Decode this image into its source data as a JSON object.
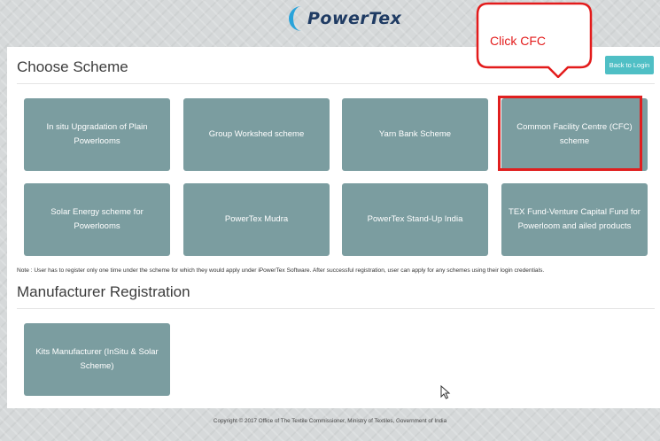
{
  "header": {
    "logo_text": "PowerTex"
  },
  "callout": {
    "text": "Click CFC"
  },
  "scheme_section": {
    "title": "Choose Scheme",
    "back_label": "Back to Login",
    "tiles": [
      {
        "label": "In situ Upgradation of Plain Powerlooms"
      },
      {
        "label": "Group Workshed scheme"
      },
      {
        "label": "Yarn Bank Scheme"
      },
      {
        "label": "Common Facility Centre (CFC) scheme"
      },
      {
        "label": "Solar Energy scheme for Powerlooms"
      },
      {
        "label": "PowerTex Mudra"
      },
      {
        "label": "PowerTex Stand-Up India"
      },
      {
        "label": "TEX Fund-Venture Capital Fund for Powerloom and ailed products"
      }
    ],
    "note": "Note : User has to register only one time under the scheme for which they would apply under iPowerTex Software. After successful registration, user can apply for any schemes using their login credentials."
  },
  "manufacturer_section": {
    "title": "Manufacturer Registration",
    "tiles": [
      {
        "label": "Kits Manufacturer (InSitu & Solar Scheme)"
      }
    ]
  },
  "footer": {
    "text": "Copyright © 2017 Office of The Textile Commissioner, Ministry of Textiles, Government of India"
  },
  "colors": {
    "tile": "#7b9da0",
    "back_button": "#4fbfc5",
    "callout_red": "#e31b1b",
    "logo_blue": "#1f3b63",
    "logo_mark": "#29a3da"
  }
}
